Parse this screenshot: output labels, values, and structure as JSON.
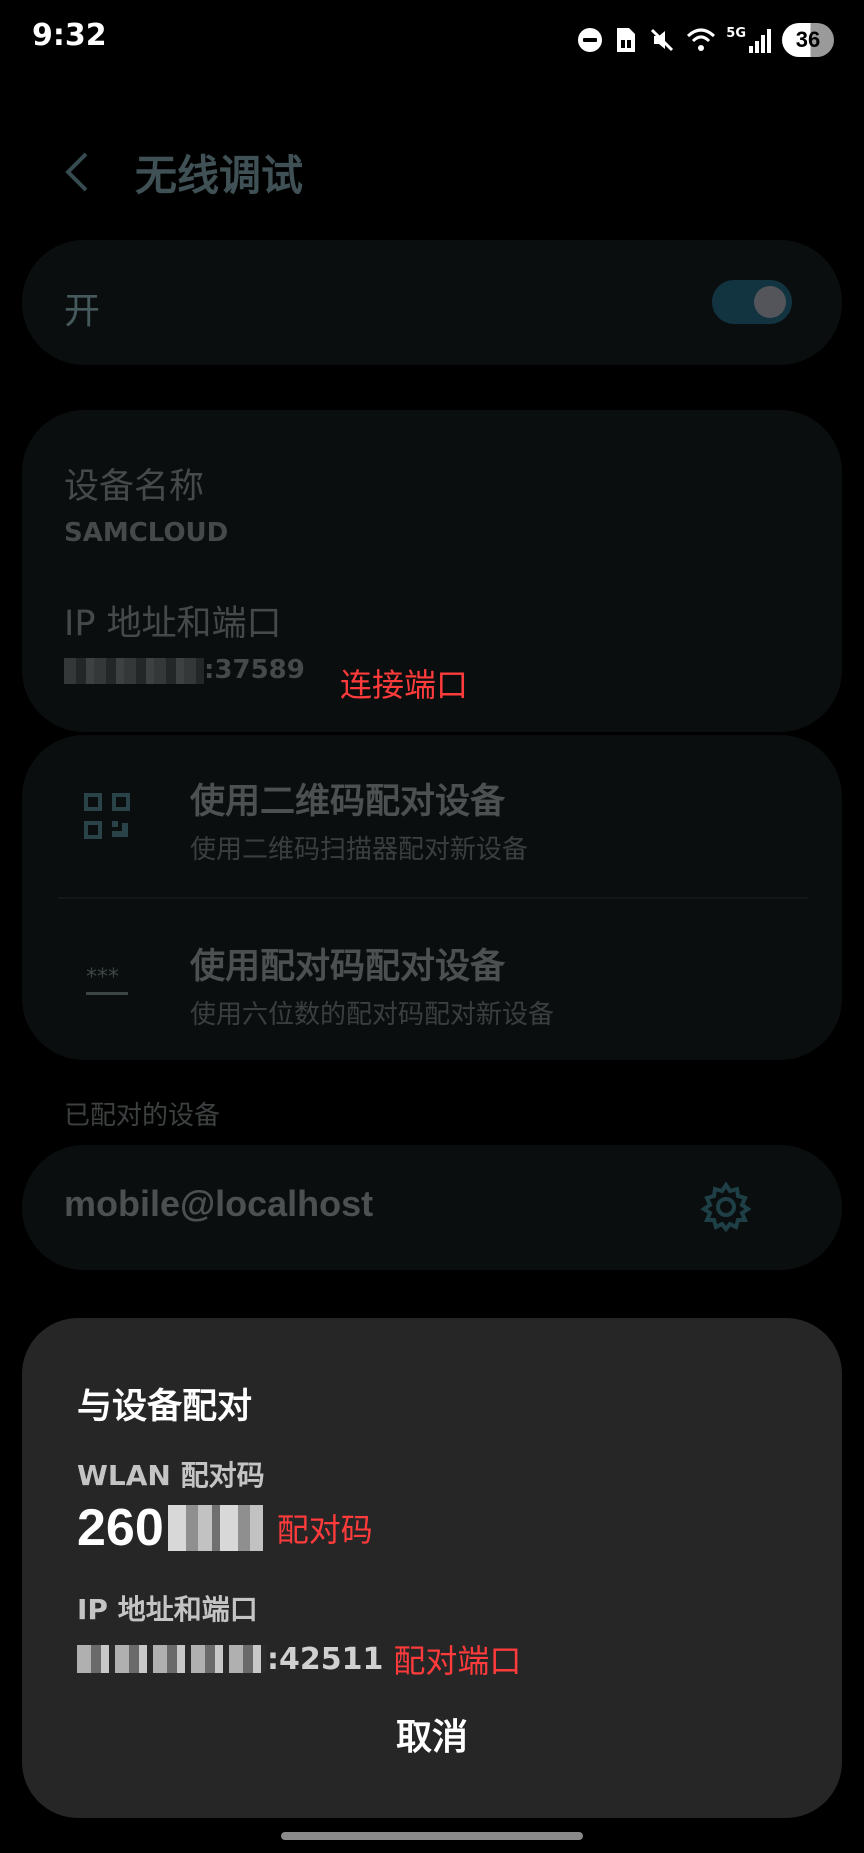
{
  "status_bar": {
    "time": "9:32",
    "network": "5G",
    "battery": "36",
    "icons": [
      "do-not-disturb-icon",
      "sim-card-icon",
      "mute-icon",
      "wifi-icon",
      "signal-icon"
    ]
  },
  "header": {
    "title": "无线调试",
    "back_icon": "back-arrow-icon"
  },
  "toggle": {
    "label": "开",
    "state": "on",
    "accent": "#2f8aa8"
  },
  "device_info": {
    "name_label": "设备名称",
    "name_value": "SAMCLOUD",
    "ip_label": "IP 地址和端口",
    "ip_port": ":37589",
    "ip_annotation": "连接端口"
  },
  "pairing_options": [
    {
      "icon": "qr-code-icon",
      "title": "使用二维码配对设备",
      "description": "使用二维码扫描器配对新设备"
    },
    {
      "icon": "password-icon",
      "title": "使用配对码配对设备",
      "description": "使用六位数的配对码配对新设备"
    }
  ],
  "paired_devices": {
    "section_label": "已配对的设备",
    "items": [
      {
        "name": "mobile@localhost",
        "icon": "gear-icon"
      }
    ]
  },
  "dialog": {
    "title": "与设备配对",
    "code_label": "WLAN 配对码",
    "code_visible": "260",
    "code_annotation": "配对码",
    "ip_label": "IP 地址和端口",
    "ip_port": ":42511",
    "ip_annotation": "配对端口",
    "cancel_label": "取消"
  },
  "colors": {
    "annotation_red": "#ff3b3b",
    "dialog_bg": "#262627",
    "card_bg": "#1d2627"
  }
}
